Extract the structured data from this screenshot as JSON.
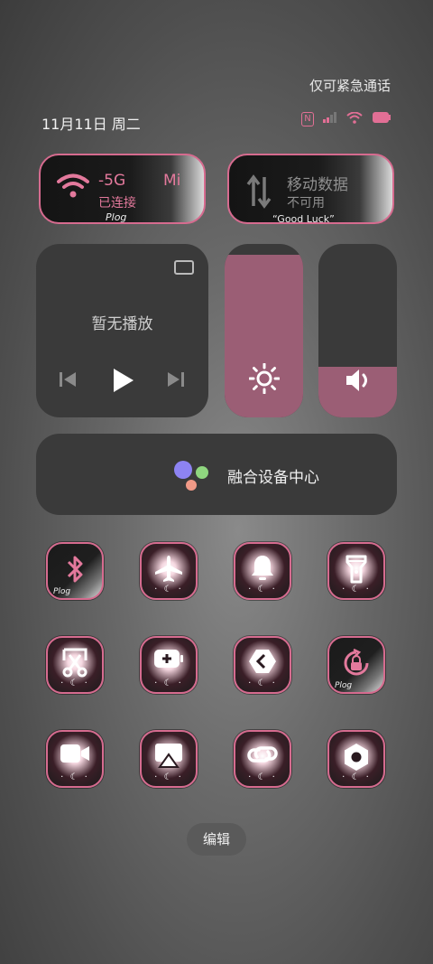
{
  "status": {
    "emergency_text": "仅可紧急通话",
    "date": "11月11日 周二",
    "icons": [
      "nfc-icon",
      "signal-icon",
      "wifi-icon",
      "battery-icon"
    ],
    "accent_color": "#e3799c"
  },
  "tiles": {
    "wifi": {
      "label_main": "-5G",
      "label_extra": "Mi",
      "sub": "已连接",
      "deco": "Plog"
    },
    "data": {
      "label_main": "移动数据",
      "sub": "不可用",
      "deco": "“Good Luck”"
    }
  },
  "media": {
    "title": "暂无播放"
  },
  "sliders": {
    "brightness_level": 0.94,
    "volume_level": 0.29
  },
  "hub": {
    "label": "融合设备中心"
  },
  "toggles": [
    {
      "name": "bluetooth",
      "icon": "bluetooth-icon"
    },
    {
      "name": "airplane",
      "icon": "airplane-icon"
    },
    {
      "name": "ring",
      "icon": "bell-icon"
    },
    {
      "name": "flashlight",
      "icon": "flashlight-icon"
    },
    {
      "name": "screenshot",
      "icon": "scissors-icon"
    },
    {
      "name": "battery-saver",
      "icon": "battery-plus-icon"
    },
    {
      "name": "share",
      "icon": "share-icon"
    },
    {
      "name": "rotation-lock",
      "icon": "rotation-lock-icon"
    },
    {
      "name": "screen-record",
      "icon": "video-camera-icon"
    },
    {
      "name": "cast",
      "icon": "screen-cast-icon"
    },
    {
      "name": "link",
      "icon": "link-icon"
    },
    {
      "name": "settings",
      "icon": "hexagon-settings-icon"
    }
  ],
  "toggle_deco": "Plog",
  "edit_label": "编辑"
}
